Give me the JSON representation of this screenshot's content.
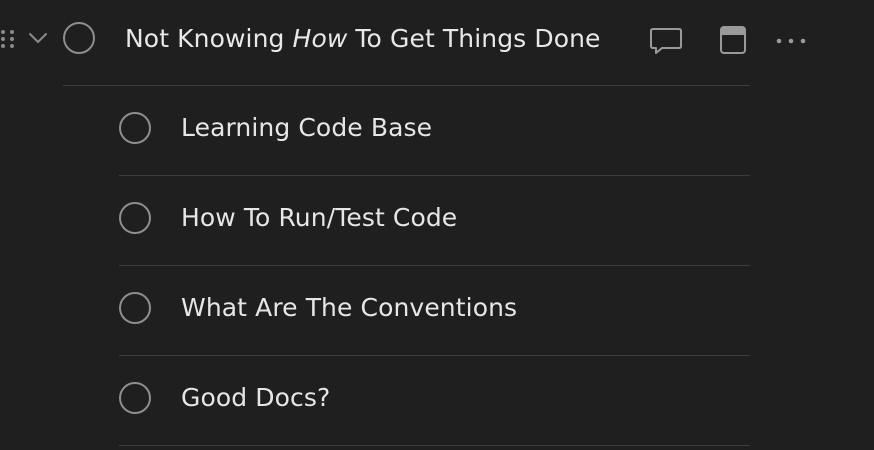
{
  "task": {
    "title_prefix": "Not Knowing ",
    "title_emphasis": "How",
    "title_suffix": " To Get Things Done",
    "icons": {
      "drag": "drag-handle-icon",
      "expand": "chevron-down-icon",
      "comment": "comment-icon",
      "date": "calendar-icon",
      "more": "more-icon"
    }
  },
  "subtasks": [
    {
      "label": "Learning Code Base"
    },
    {
      "label": "How To Run/Test Code"
    },
    {
      "label": "What Are The Conventions"
    },
    {
      "label": "Good Docs?"
    }
  ],
  "colors": {
    "background": "#1f1f1f",
    "text": "#e6e6e6",
    "circle": "#8e8e8e",
    "divider": "#3e3e3e",
    "icon": "#9a9a9a"
  }
}
